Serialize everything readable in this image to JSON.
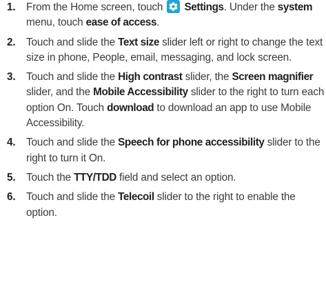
{
  "steps": [
    {
      "number": "1.",
      "parts": [
        {
          "t": "From the Home screen, touch "
        },
        {
          "icon": "gear-icon"
        },
        {
          "t": " "
        },
        {
          "t": "Settings",
          "b": true
        },
        {
          "t": ". Under the "
        },
        {
          "t": "system",
          "b": true
        },
        {
          "t": " menu, touch "
        },
        {
          "t": "ease of access",
          "b": true
        },
        {
          "t": "."
        }
      ]
    },
    {
      "number": "2.",
      "parts": [
        {
          "t": "Touch and slide the "
        },
        {
          "t": "Text size",
          "b": true
        },
        {
          "t": " slider left or right to change the text size in phone, People, email, messaging, and lock screen."
        }
      ]
    },
    {
      "number": "3.",
      "parts": [
        {
          "t": "Touch and slide the "
        },
        {
          "t": "High contrast",
          "b": true
        },
        {
          "t": " slider, the "
        },
        {
          "t": "Screen magnifier",
          "b": true
        },
        {
          "t": " slider, and the "
        },
        {
          "t": "Mobile Accessibility",
          "b": true
        },
        {
          "t": " slider to the right to turn each option On. Touch "
        },
        {
          "t": "download",
          "b": true
        },
        {
          "t": " to download an app to use Mobile Accessibility."
        }
      ]
    },
    {
      "number": "4.",
      "parts": [
        {
          "t": "Touch and slide the "
        },
        {
          "t": "Speech for phone accessibility",
          "b": true
        },
        {
          "t": " slider to the right to turn it On."
        }
      ]
    },
    {
      "number": "5.",
      "parts": [
        {
          "t": "Touch the "
        },
        {
          "t": "TTY/TDD",
          "b": true
        },
        {
          "t": " field and select an option."
        }
      ]
    },
    {
      "number": "6.",
      "parts": [
        {
          "t": "Touch and slide the "
        },
        {
          "t": "Telecoil",
          "b": true
        },
        {
          "t": " slider to the right to enable the option."
        }
      ]
    }
  ],
  "colors": {
    "text": "#3a3a3a",
    "bold_text": "#1f1f1f",
    "icon_background": "#22a3d4"
  }
}
